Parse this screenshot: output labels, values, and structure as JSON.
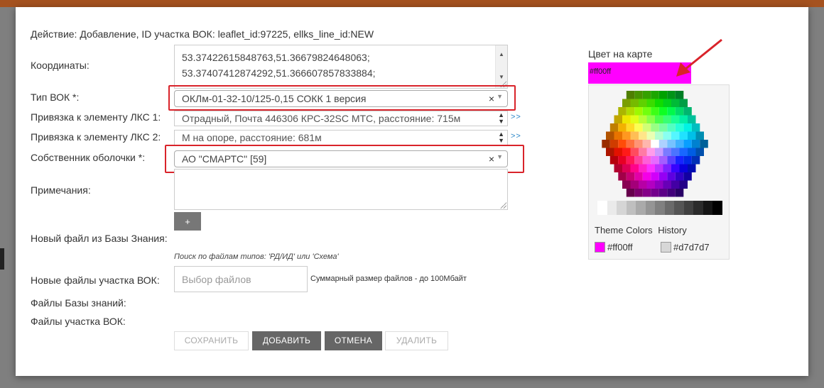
{
  "action_line": "Действие: Добавление, ID участка ВОК: leaflet_id:97225, ellks_line_id:NEW",
  "form": {
    "coordinates": {
      "label": "Координаты:",
      "lines": [
        "53.37422615848763,51.36679824648063;",
        "53.37407412874292,51.366607857833884;"
      ]
    },
    "vok_type": {
      "label": "Тип ВОК *:",
      "value": "ОКЛм-01-32-10/125-0,15 СОКК 1 версия",
      "clear": "×",
      "arrow": "▼"
    },
    "lks_link_1": {
      "label": "Привязка к элементу ЛКС 1:",
      "value": "Отрадный, Почта 446306 КРС-32SC МТС, расстояние: 715м",
      "more": ">>"
    },
    "lks_link_2": {
      "label": "Привязка к элементу ЛКС 2:",
      "value": "М на опоре, расстояние: 681м",
      "more": ">>"
    },
    "owner": {
      "label": "Собственник оболочки *:",
      "value": "АО \"СМАРТС\" [59]",
      "clear": "×",
      "arrow": "▼"
    },
    "notes": {
      "label": "Примечания:",
      "value": ""
    },
    "plus_label": "+",
    "kb_file": {
      "label": "Новый файл из Базы Знания:",
      "hint": "Поиск по файлам типов: 'РД/ИД' или 'Схема'"
    },
    "new_files": {
      "label": "Новые файлы участка ВОК:",
      "placeholder": "Выбор файлов",
      "size_note": "Суммарный размер файлов - до 100Мбайт"
    },
    "kb_files_label": "Файлы Базы знаний:",
    "section_files_label": "Файлы участка ВОК:"
  },
  "buttons": {
    "save": "СОХРАНИТЬ",
    "add": "ДОБАВИТЬ",
    "cancel": "ОТМЕНА",
    "delete": "УДАЛИТЬ"
  },
  "color_picker": {
    "label": "Цвет на карте",
    "value": "#ff00ff",
    "tab_theme": "Theme Colors",
    "tab_history": "History",
    "history": [
      {
        "color": "#ff00ff",
        "label": "#ff00ff"
      },
      {
        "color": "#d7d7d7",
        "label": "#d7d7d7"
      }
    ]
  },
  "colors": {
    "accent_dark": "#666666",
    "highlight_red": "#d9232a",
    "link_blue": "#2a86c8",
    "topbar": "#a5521f"
  },
  "icons": [
    "close-icon",
    "dropdown-arrow-icon",
    "resize-handle-icon",
    "spinner-arrows-icon",
    "annotation-arrow-icon"
  ]
}
